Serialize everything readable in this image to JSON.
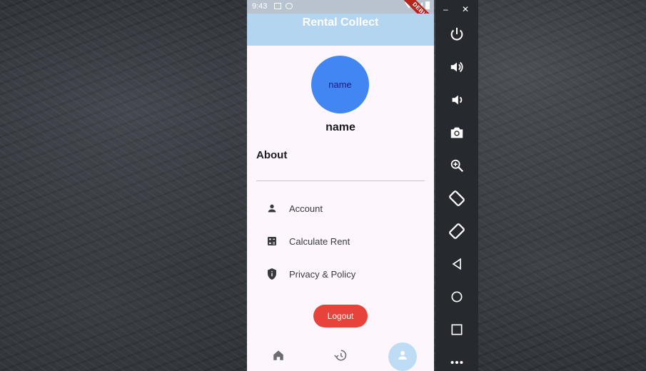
{
  "status_bar": {
    "time": "9:43",
    "debug_label": "DEBUG"
  },
  "app": {
    "title": "Rental Collect"
  },
  "profile": {
    "avatar_text": "name",
    "name": "name"
  },
  "section": {
    "about_label": "About"
  },
  "menu": {
    "items": [
      {
        "label": "Account",
        "icon": "person-icon"
      },
      {
        "label": "Calculate Rent",
        "icon": "calculator-icon"
      },
      {
        "label": "Privacy & Policy",
        "icon": "shield-icon"
      }
    ]
  },
  "logout": {
    "label": "Logout"
  },
  "bottom_nav": {
    "items": [
      {
        "icon": "home-icon",
        "active": false
      },
      {
        "icon": "history-icon",
        "active": false
      },
      {
        "icon": "person-icon",
        "active": true
      }
    ]
  },
  "emulator": {
    "window_controls": {
      "minimize": "–",
      "close": "✕"
    },
    "buttons": [
      "power-icon",
      "volume-up-icon",
      "volume-down-icon",
      "camera-icon",
      "zoom-in-icon",
      "rotate-left-icon",
      "rotate-right-icon",
      "back-icon",
      "home-circle-icon",
      "overview-icon",
      "more-icon"
    ]
  },
  "colors": {
    "appbar": "#b4d5f0",
    "avatar": "#4286f4",
    "logout": "#e8433a",
    "active_nav": "#bfdcf5"
  }
}
